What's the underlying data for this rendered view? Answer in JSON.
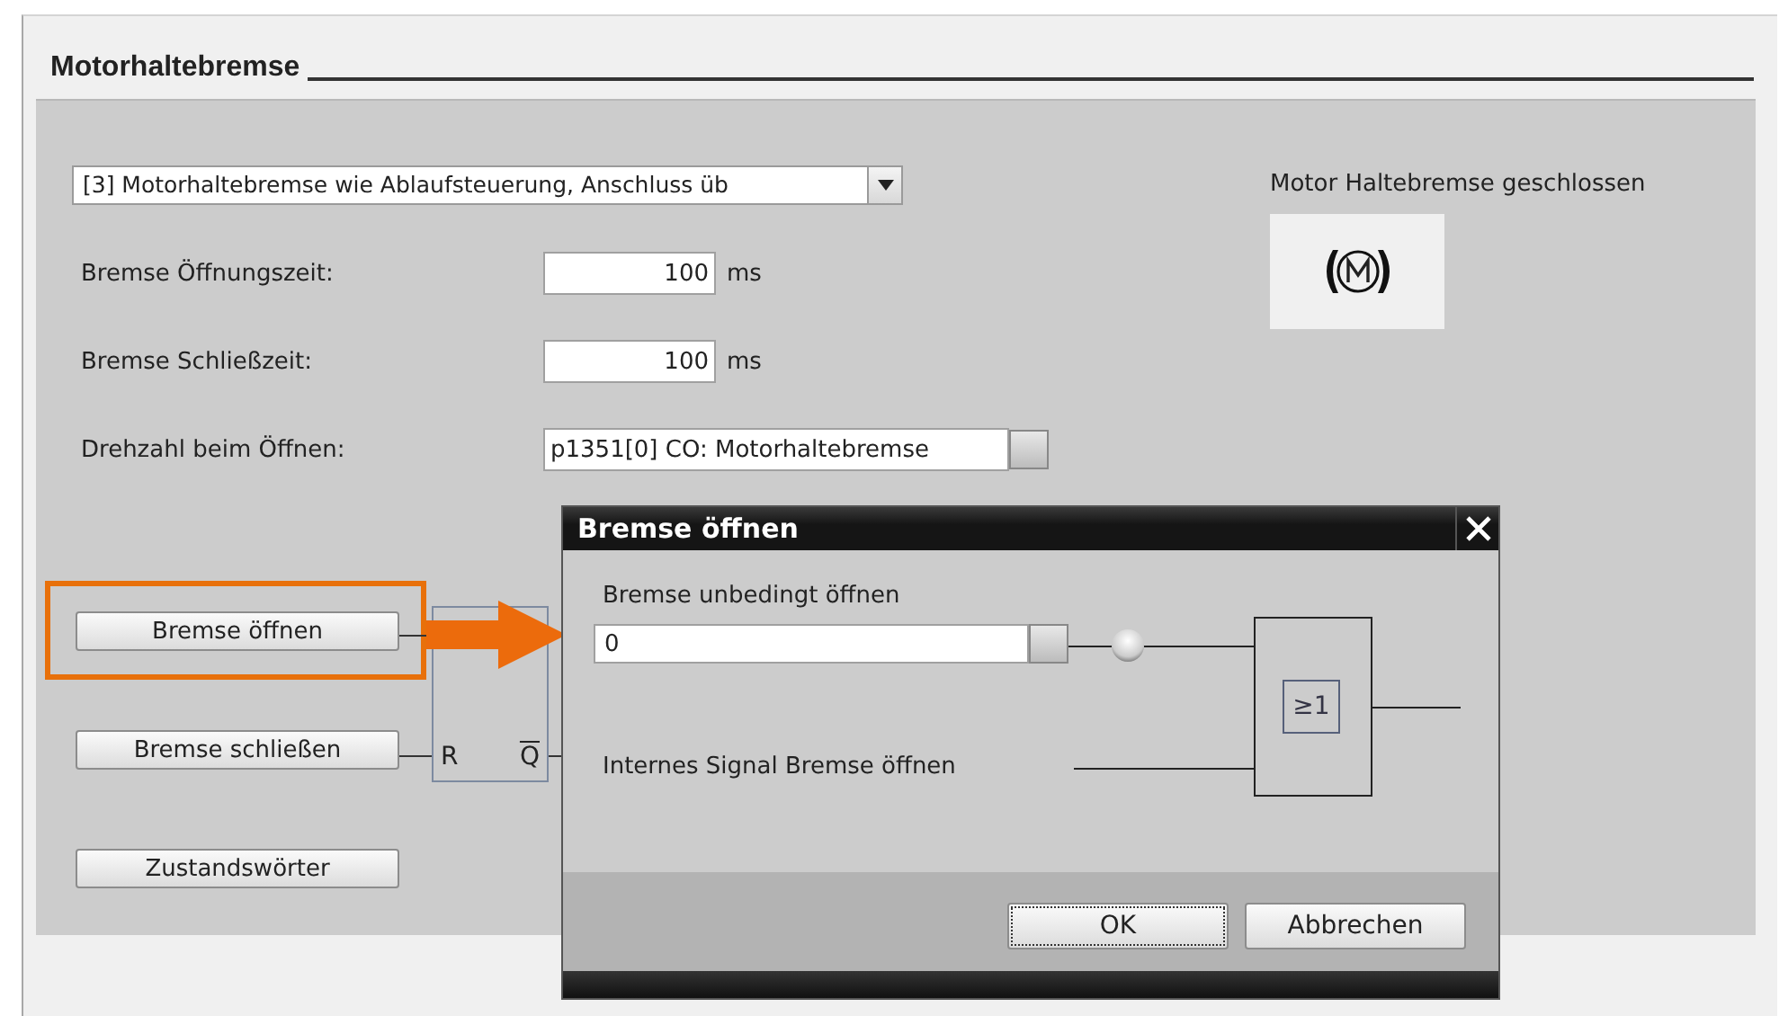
{
  "section": {
    "title": "Motorhaltebremse"
  },
  "mode_select": {
    "value": "[3] Motorhaltebremse wie Ablaufsteuerung, Anschluss üb"
  },
  "fields": [
    {
      "kind": "number",
      "label": "Bremse Öffnungszeit:",
      "value": "100",
      "unit": "ms"
    },
    {
      "kind": "number",
      "label": "Bremse Schließzeit:",
      "value": "100",
      "unit": "ms"
    },
    {
      "kind": "connector",
      "label": "Drehzahl beim Öffnen:",
      "value": "p1351[0] CO: Motorhaltebremse"
    }
  ],
  "status": {
    "text": "Motor Haltebremse geschlossen"
  },
  "buttons": [
    {
      "label": "Bremse öffnen",
      "highlighted": true
    },
    {
      "label": "Bremse schließen",
      "highlighted": false
    },
    {
      "label": "Zustandswörter",
      "highlighted": false
    }
  ],
  "flipflop": {
    "reset": "R",
    "output": "Q",
    "output_inverted": true
  },
  "dialog": {
    "title": "Bremse öffnen",
    "input_label": "Bremse unbedingt öffnen",
    "input_value": "0",
    "signal_label": "Internes Signal Bremse öffnen",
    "gate": "≥1",
    "buttons": [
      {
        "label": "OK",
        "focused": true
      },
      {
        "label": "Abbrechen",
        "focused": false
      }
    ]
  }
}
